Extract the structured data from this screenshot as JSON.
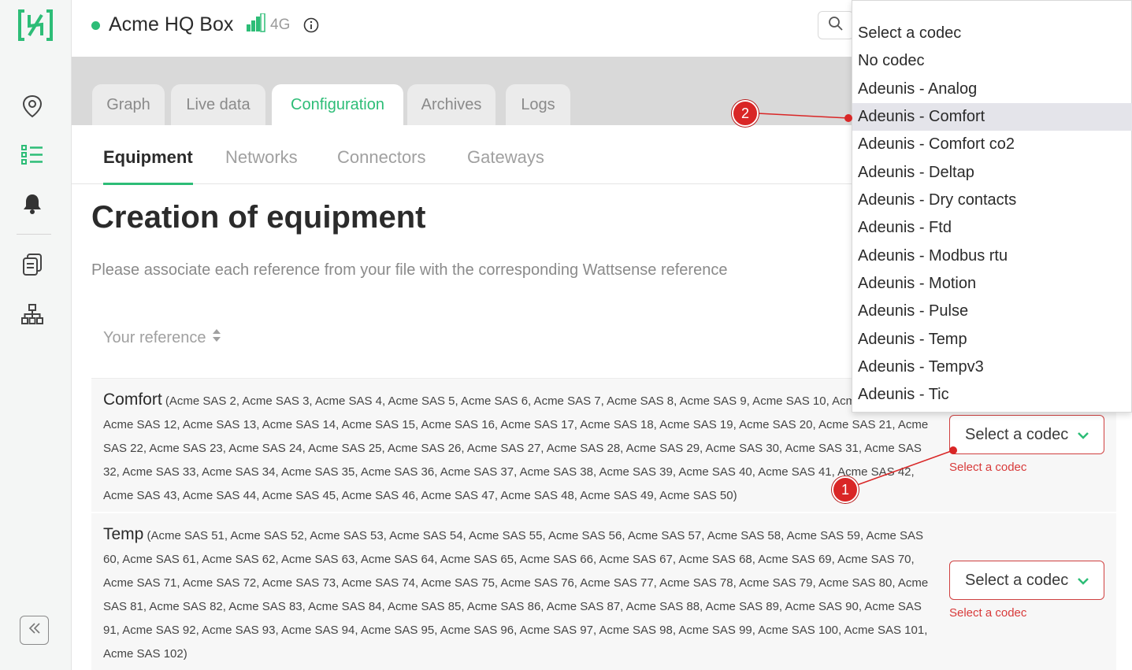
{
  "header": {
    "device_name": "Acme HQ Box",
    "network_type": "4G"
  },
  "main_tabs": [
    {
      "label": "Graph"
    },
    {
      "label": "Live data"
    },
    {
      "label": "Configuration"
    },
    {
      "label": "Archives"
    },
    {
      "label": "Logs"
    }
  ],
  "sub_tabs": [
    {
      "label": "Equipment"
    },
    {
      "label": "Networks"
    },
    {
      "label": "Connectors"
    },
    {
      "label": "Gateways"
    }
  ],
  "page": {
    "title": "Creation of equipment",
    "description": "Please associate each reference from your file with the corresponding Wattsense reference",
    "column_header": "Your reference"
  },
  "rows": [
    {
      "name": "Comfort",
      "refs": "(Acme SAS 2, Acme SAS 3, Acme SAS 4, Acme SAS 5, Acme SAS 6, Acme SAS 7, Acme SAS 8, Acme SAS 9, Acme SAS 10, Acme SAS 11, Acme SAS 12, Acme SAS 13, Acme SAS 14, Acme SAS 15, Acme SAS 16, Acme SAS 17, Acme SAS 18, Acme SAS 19, Acme SAS 20, Acme SAS 21, Acme SAS 22, Acme SAS 23, Acme SAS 24, Acme SAS 25, Acme SAS 26, Acme SAS 27, Acme SAS 28, Acme SAS 29, Acme SAS 30, Acme SAS 31, Acme SAS 32, Acme SAS 33, Acme SAS 34, Acme SAS 35, Acme SAS 36, Acme SAS 37, Acme SAS 38, Acme SAS 39, Acme SAS 40, Acme SAS 41, Acme SAS 42, Acme SAS 43, Acme SAS 44, Acme SAS 45, Acme SAS 46, Acme SAS 47, Acme SAS 48, Acme SAS 49, Acme SAS 50)",
      "select_value": "Select a codec",
      "error": "Select a codec"
    },
    {
      "name": "Temp",
      "refs": "(Acme SAS 51, Acme SAS 52, Acme SAS 53, Acme SAS 54, Acme SAS 55, Acme SAS 56, Acme SAS 57, Acme SAS 58, Acme SAS 59, Acme SAS 60, Acme SAS 61, Acme SAS 62, Acme SAS 63, Acme SAS 64, Acme SAS 65, Acme SAS 66, Acme SAS 67, Acme SAS 68, Acme SAS 69, Acme SAS 70, Acme SAS 71, Acme SAS 72, Acme SAS 73, Acme SAS 74, Acme SAS 75, Acme SAS 76, Acme SAS 77, Acme SAS 78, Acme SAS 79, Acme SAS 80, Acme SAS 81, Acme SAS 82, Acme SAS 83, Acme SAS 84, Acme SAS 85, Acme SAS 86, Acme SAS 87, Acme SAS 88, Acme SAS 89, Acme SAS 90, Acme SAS 91, Acme SAS 92, Acme SAS 93, Acme SAS 94, Acme SAS 95, Acme SAS 96, Acme SAS 97, Acme SAS 98, Acme SAS 99, Acme SAS 100, Acme SAS 101, Acme SAS 102)",
      "select_value": "Select a codec",
      "error": "Select a codec"
    }
  ],
  "dropdown": {
    "options": [
      "Select a codec",
      "No codec",
      "Adeunis - Analog",
      "Adeunis - Comfort",
      "Adeunis - Comfort co2",
      "Adeunis - Deltap",
      "Adeunis - Dry contacts",
      "Adeunis - Ftd",
      "Adeunis - Modbus rtu",
      "Adeunis - Motion",
      "Adeunis - Pulse",
      "Adeunis - Temp",
      "Adeunis - Tempv3",
      "Adeunis - Tic"
    ],
    "highlighted": "Adeunis - Comfort"
  },
  "annotations": {
    "marker1": "1",
    "marker2": "2"
  },
  "colors": {
    "accent": "#2dbd77",
    "error": "#d83a3a",
    "marker": "#d92626"
  }
}
